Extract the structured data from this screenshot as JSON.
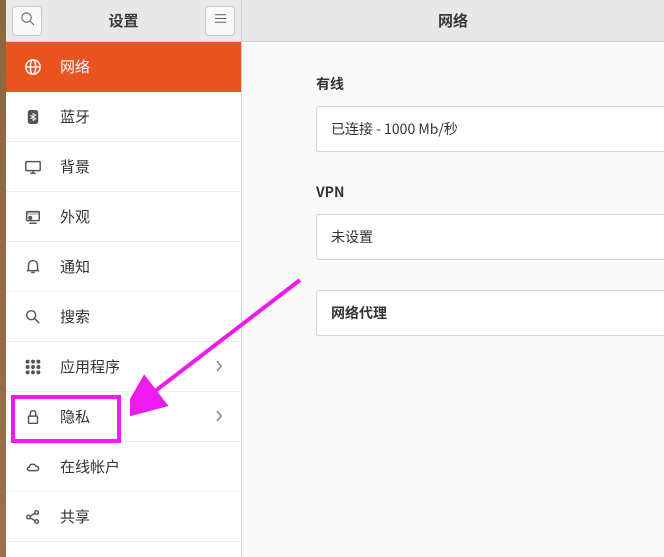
{
  "sidebar": {
    "title": "设置",
    "items": [
      {
        "label": "网络",
        "icon": "globe",
        "active": true,
        "chevron": false
      },
      {
        "label": "蓝牙",
        "icon": "bluetooth",
        "active": false,
        "chevron": false
      },
      {
        "label": "背景",
        "icon": "display",
        "active": false,
        "chevron": false
      },
      {
        "label": "外观",
        "icon": "appearance",
        "active": false,
        "chevron": false
      },
      {
        "label": "通知",
        "icon": "bell",
        "active": false,
        "chevron": false
      },
      {
        "label": "搜索",
        "icon": "search",
        "active": false,
        "chevron": false
      },
      {
        "label": "应用程序",
        "icon": "grid",
        "active": false,
        "chevron": true
      },
      {
        "label": "隐私",
        "icon": "lock",
        "active": false,
        "chevron": true
      },
      {
        "label": "在线帐户",
        "icon": "cloud",
        "active": false,
        "chevron": false
      },
      {
        "label": "共享",
        "icon": "share",
        "active": false,
        "chevron": false
      }
    ]
  },
  "main": {
    "title": "网络",
    "wired": {
      "heading": "有线",
      "status": "已连接 - 1000 Mb/秒"
    },
    "vpn": {
      "heading": "VPN",
      "status": "未设置"
    },
    "proxy": {
      "heading": "网络代理"
    }
  },
  "annotation": {
    "highlight_target": "隐私"
  }
}
